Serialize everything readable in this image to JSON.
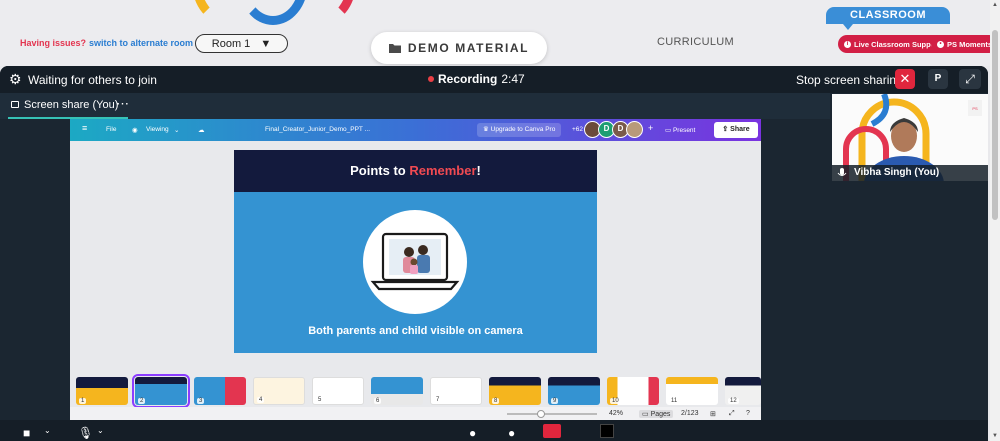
{
  "header": {
    "issues_text": "Having issues?",
    "alternate_link": "switch to alternate room",
    "room_select": "Room 1",
    "demo_material": "DEMO MATERIAL",
    "curriculum": "CURRICULUM",
    "classroom": "CLASSROOM",
    "live_support": "Live Classroom Support",
    "ps_moments": "PS Moments"
  },
  "meeting": {
    "waiting": "Waiting for others to join",
    "recording_label": "Recording",
    "recording_time": "2:47",
    "stop_sharing": "Stop screen sharing",
    "p_button": "P",
    "screen_share_label": "Screen share (You)",
    "self_name": "Vibha Singh (You)"
  },
  "canva": {
    "menu": [
      "File",
      "Viewing"
    ],
    "doc_title": "Final_Creator_Junior_Demo_PPT ...",
    "upgrade": "Upgrade to Canva Pro",
    "collab_count": "+62",
    "avatar_d1": "D",
    "avatar_d2": "D",
    "present": "Present",
    "share": "Share",
    "slide": {
      "title_pre": "Points to ",
      "title_hl": "Remember",
      "title_post": "!",
      "caption": "Both parents and child visible on camera"
    },
    "thumb_numbers": [
      "1",
      "2",
      "3",
      "4",
      "5",
      "6",
      "7",
      "8",
      "9",
      "10",
      "11",
      "12"
    ],
    "footer": {
      "zoom": "42%",
      "pages": "Pages",
      "page_count": "2/123"
    }
  },
  "colors": {
    "accent_red": "#e0263d",
    "accent_blue": "#3a8ed7",
    "teal": "#36c2b6",
    "canva_purple": "#8b3dff"
  }
}
